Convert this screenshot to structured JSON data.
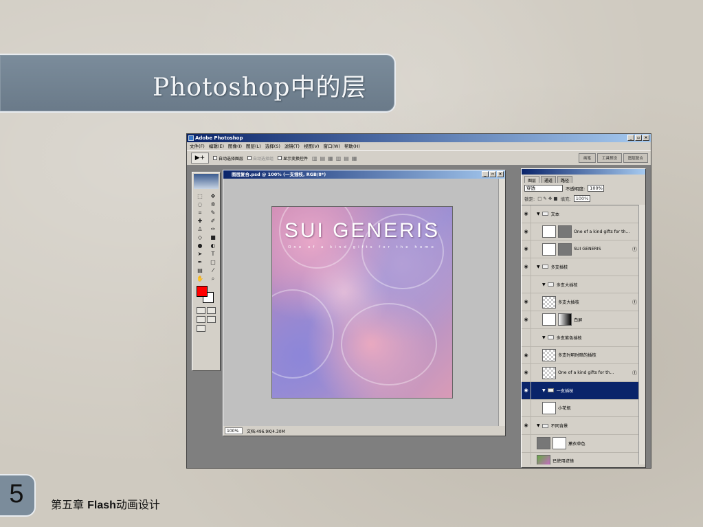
{
  "slide": {
    "title": "Photoshop中的层",
    "page_number": "5",
    "footer_prefix": "第五章 ",
    "footer_bold": "Flash",
    "footer_suffix": "动画设计"
  },
  "app": {
    "title": "Adobe Photoshop",
    "window_buttons": [
      "_",
      "▫",
      "×"
    ],
    "menu": [
      "文件(F)",
      "编辑(E)",
      "图像(I)",
      "图层(L)",
      "选择(S)",
      "滤镜(T)",
      "视图(V)",
      "窗口(W)",
      "帮助(H)"
    ],
    "options": {
      "tool_icon": "▶+",
      "auto_select_layer": "自动选择图层",
      "auto_select_group": "自动选择组",
      "show_transform": "显示变换控件"
    },
    "palette_well": [
      "画笔",
      "工具预设",
      "图层复合"
    ]
  },
  "document": {
    "title": "图层复合.psd @ 100% (一支插枝, RGB/8*)",
    "art_title": "SUI GENERIS",
    "art_subtitle": "One of a kind gifts for the home",
    "status_zoom": "100%",
    "status_doc": "文档:496.9K/4.30M"
  },
  "layers_panel": {
    "tabs": [
      "图层",
      "通道",
      "路径"
    ],
    "blend_mode": "穿透",
    "opacity_label": "不透明度:",
    "opacity_value": "100%",
    "lock_label": "锁定:",
    "fill_label": "填充:",
    "fill_value": "100%",
    "layers": [
      {
        "name": "文本",
        "type": "group",
        "level": 0,
        "visible": true
      },
      {
        "name": "One of a kind gifts for th...",
        "type": "text",
        "level": 1,
        "visible": true
      },
      {
        "name": "SUI GENERIS",
        "type": "text",
        "level": 1,
        "visible": true
      },
      {
        "name": "多支插枝",
        "type": "group",
        "level": 0,
        "visible": true
      },
      {
        "name": "多支大插枝",
        "type": "group",
        "level": 1,
        "visible": false
      },
      {
        "name": "多支大插枝",
        "type": "layer",
        "level": 2,
        "visible": true
      },
      {
        "name": "白屏",
        "type": "mask",
        "level": 2,
        "visible": true
      },
      {
        "name": "多支紫色插枝",
        "type": "group",
        "level": 1,
        "visible": false
      },
      {
        "name": "多支时明时暗的插枝",
        "type": "layer",
        "level": 2,
        "visible": true
      },
      {
        "name": "One of a kind gifts for th...",
        "type": "layer",
        "level": 2,
        "visible": true
      },
      {
        "name": "一支插枝",
        "type": "group",
        "level": 1,
        "visible": true,
        "selected": true
      },
      {
        "name": "小花瓶",
        "type": "layer",
        "level": 2,
        "visible": false
      },
      {
        "name": "不同背景",
        "type": "group",
        "level": 0,
        "visible": true
      },
      {
        "name": "薰衣草色",
        "type": "layer",
        "level": 1,
        "visible": false
      },
      {
        "name": "已使用滤镜",
        "type": "layer",
        "level": 1,
        "visible": false
      }
    ]
  }
}
